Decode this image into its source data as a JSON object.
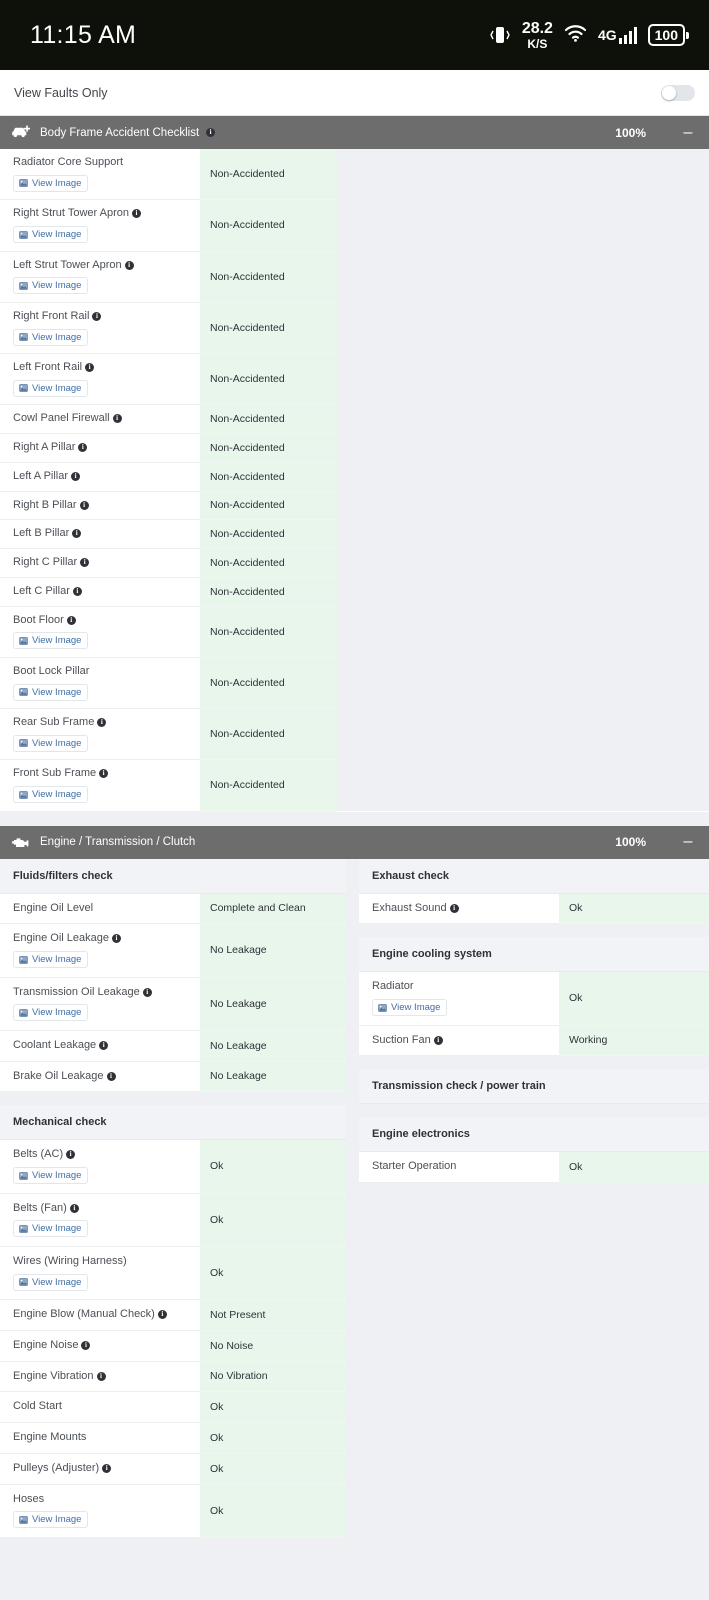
{
  "statusbar": {
    "time": "11:15 AM",
    "vibrate_icon": "vibrate-icon",
    "data_speed_value": "28.2",
    "data_speed_unit": "K/S",
    "wifi_icon": "wifi-icon",
    "network_type": "4G",
    "signal_icon": "signal-bars-icon",
    "battery_level": "100"
  },
  "faults_bar": {
    "label": "View Faults Only",
    "toggle_state": "off"
  },
  "sections": [
    {
      "id": "body-frame-accident-checklist",
      "icon": "car-plus-icon",
      "title": "Body Frame Accident Checklist",
      "has_info": true,
      "percent": "100%",
      "collapse_label": "–",
      "rows": [
        {
          "name": "Radiator Core Support",
          "info": false,
          "view_image": "View Image",
          "value": "Non-Accidented"
        },
        {
          "name": "Right Strut Tower Apron",
          "info": true,
          "view_image": "View Image",
          "value": "Non-Accidented"
        },
        {
          "name": "Left Strut Tower Apron",
          "info": true,
          "view_image": "View Image",
          "value": "Non-Accidented"
        },
        {
          "name": "Right Front Rail",
          "info": true,
          "view_image": "View Image",
          "value": "Non-Accidented"
        },
        {
          "name": "Left Front Rail",
          "info": true,
          "view_image": "View Image",
          "value": "Non-Accidented"
        },
        {
          "name": "Cowl Panel Firewall",
          "info": true,
          "view_image": null,
          "value": "Non-Accidented"
        },
        {
          "name": "Right A Pillar",
          "info": true,
          "view_image": null,
          "value": "Non-Accidented"
        },
        {
          "name": "Left A Pillar",
          "info": true,
          "view_image": null,
          "value": "Non-Accidented"
        },
        {
          "name": "Right B Pillar",
          "info": true,
          "view_image": null,
          "value": "Non-Accidented"
        },
        {
          "name": "Left B Pillar",
          "info": true,
          "view_image": null,
          "value": "Non-Accidented"
        },
        {
          "name": "Right C Pillar",
          "info": true,
          "view_image": null,
          "value": "Non-Accidented"
        },
        {
          "name": "Left C Pillar",
          "info": true,
          "view_image": null,
          "value": "Non-Accidented"
        },
        {
          "name": "Boot Floor",
          "info": true,
          "view_image": "View Image",
          "value": "Non-Accidented"
        },
        {
          "name": "Boot Lock Pillar",
          "info": false,
          "view_image": "View Image",
          "value": "Non-Accidented"
        },
        {
          "name": "Rear Sub Frame",
          "info": true,
          "view_image": "View Image",
          "value": "Non-Accidented"
        },
        {
          "name": "Front Sub Frame",
          "info": true,
          "view_image": "View Image",
          "value": "Non-Accidented"
        }
      ]
    },
    {
      "id": "engine-transmission-clutch",
      "icon": "engine-icon",
      "title": "Engine / Transmission / Clutch",
      "has_info": false,
      "percent": "100%",
      "collapse_label": "–",
      "left_groups": [
        {
          "heading": "Fluids/filters check",
          "rows": [
            {
              "name": "Engine Oil Level",
              "info": false,
              "view_image": null,
              "value": "Complete and Clean"
            },
            {
              "name": "Engine Oil Leakage",
              "info": true,
              "view_image": "View Image",
              "value": "No Leakage"
            },
            {
              "name": "Transmission Oil Leakage",
              "info": true,
              "view_image": "View Image",
              "value": "No Leakage"
            },
            {
              "name": "Coolant Leakage",
              "info": true,
              "view_image": null,
              "value": "No Leakage"
            },
            {
              "name": "Brake Oil Leakage",
              "info": true,
              "view_image": null,
              "value": "No Leakage"
            }
          ]
        },
        {
          "heading": "Mechanical check",
          "rows": [
            {
              "name": "Belts (AC)",
              "info": true,
              "view_image": "View Image",
              "value": "Ok"
            },
            {
              "name": "Belts (Fan)",
              "info": true,
              "view_image": "View Image",
              "value": "Ok"
            },
            {
              "name": "Wires (Wiring Harness)",
              "info": false,
              "view_image": "View Image",
              "value": "Ok"
            },
            {
              "name": "Engine Blow (Manual Check)",
              "info": true,
              "view_image": null,
              "value": "Not Present"
            },
            {
              "name": "Engine Noise",
              "info": true,
              "view_image": null,
              "value": "No Noise"
            },
            {
              "name": "Engine Vibration",
              "info": true,
              "view_image": null,
              "value": "No Vibration"
            },
            {
              "name": "Cold Start",
              "info": false,
              "view_image": null,
              "value": "Ok"
            },
            {
              "name": "Engine Mounts",
              "info": false,
              "view_image": null,
              "value": "Ok"
            },
            {
              "name": "Pulleys (Adjuster)",
              "info": true,
              "view_image": null,
              "value": "Ok"
            },
            {
              "name": "Hoses",
              "info": false,
              "view_image": "View Image",
              "value": "Ok"
            }
          ]
        }
      ],
      "right_groups": [
        {
          "heading": "Exhaust check",
          "rows": [
            {
              "name": "Exhaust Sound",
              "info": true,
              "view_image": null,
              "value": "Ok"
            }
          ]
        },
        {
          "heading": "Engine cooling system",
          "rows": [
            {
              "name": "Radiator",
              "info": false,
              "view_image": "View Image",
              "value": "Ok"
            },
            {
              "name": "Suction Fan",
              "info": true,
              "view_image": null,
              "value": "Working"
            }
          ]
        },
        {
          "heading": "Transmission check / power train",
          "rows": []
        },
        {
          "heading": "Engine electronics",
          "rows": [
            {
              "name": "Starter Operation",
              "info": false,
              "view_image": null,
              "value": "Ok"
            }
          ]
        }
      ]
    }
  ],
  "colors": {
    "status_bar_bg": "#0d1109",
    "section_header_bg": "#6d6d6d",
    "ok_value_bg": "#e8f6ec",
    "page_bg": "#eef0f4",
    "link": "#3f6fa5"
  }
}
